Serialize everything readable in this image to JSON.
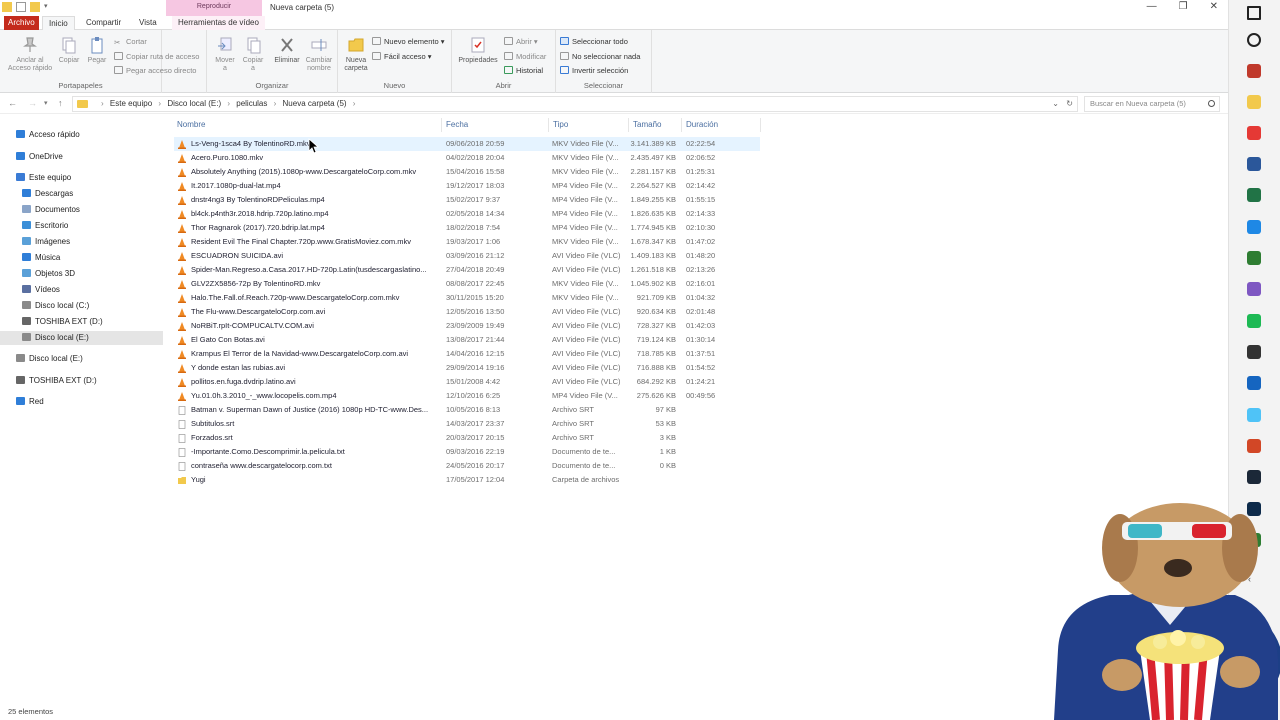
{
  "window": {
    "title": "Nueva carpeta (5)",
    "context_tab": "Reproducir",
    "controls": [
      "—",
      "❐",
      "✕"
    ]
  },
  "tabs": {
    "archivo": "Archivo",
    "inicio": "Inicio",
    "compartir": "Compartir",
    "vista": "Vista",
    "herramientas": "Herramientas de vídeo"
  },
  "ribbon": {
    "portapapeles": {
      "label": "Portapapeles",
      "anclar": "Anclar al\nAcceso rápido",
      "copiar": "Copiar",
      "pegar": "Pegar",
      "cortar": "Cortar",
      "copiar_ruta": "Copiar ruta de acceso",
      "pegar_acceso": "Pegar acceso directo"
    },
    "organizar": {
      "label": "Organizar",
      "mover": "Mover\na",
      "copiar_a": "Copiar\na",
      "eliminar": "Eliminar",
      "cambiar_nombre": "Cambiar\nnombre"
    },
    "nuevo": {
      "label": "Nuevo",
      "nueva_carpeta": "Nueva\ncarpeta",
      "nuevo_elemento": "Nuevo elemento",
      "facil_acceso": "Fácil acceso"
    },
    "abrir": {
      "label": "Abrir",
      "propiedades": "Propiedades",
      "abrir": "Abrir",
      "modificar": "Modificar",
      "historial": "Historial"
    },
    "seleccionar": {
      "label": "Seleccionar",
      "todo": "Seleccionar todo",
      "nada": "No seleccionar nada",
      "invertir": "Invertir selección"
    }
  },
  "address": {
    "crumbs": [
      "Este equipo",
      "Disco local (E:)",
      "peliculas",
      "Nueva carpeta (5)"
    ],
    "search_placeholder": "Buscar en Nueva carpeta (5)"
  },
  "sidebar": {
    "items": [
      {
        "label": "Acceso rápido",
        "color": "#2f7ed8"
      },
      {
        "label": "OneDrive",
        "color": "#2f7ed8"
      },
      {
        "label": "Este equipo",
        "color": "#3a7bd5"
      },
      {
        "label": "Descargas",
        "color": "#2f7ed8"
      },
      {
        "label": "Documentos",
        "color": "#8aa4c8"
      },
      {
        "label": "Escritorio",
        "color": "#3b8fd8"
      },
      {
        "label": "Imágenes",
        "color": "#5aa0d8"
      },
      {
        "label": "Música",
        "color": "#2f7ed8"
      },
      {
        "label": "Objetos 3D",
        "color": "#5aa0d8"
      },
      {
        "label": "Vídeos",
        "color": "#5a6fa0"
      },
      {
        "label": "Disco local (C:)",
        "color": "#8a8a8a"
      },
      {
        "label": "TOSHIBA EXT (D:)",
        "color": "#666666"
      },
      {
        "label": "Disco local (E:)",
        "color": "#8a8a8a"
      },
      {
        "label": "Disco local (E:)",
        "color": "#8a8a8a"
      },
      {
        "label": "TOSHIBA EXT (D:)",
        "color": "#666666"
      },
      {
        "label": "Red",
        "color": "#2f7ed8"
      }
    ]
  },
  "columns": {
    "nombre": "Nombre",
    "fecha": "Fecha",
    "tipo": "Tipo",
    "tamano": "Tamaño",
    "duracion": "Duración"
  },
  "files": [
    {
      "name": "Ls-Veng-1sca4 By TolentinoRD.mkv",
      "date": "09/06/2018 20:59",
      "type": "MKV Video File (V...",
      "size": "3.141.389 KB",
      "dur": "02:22:54",
      "kind": "vlc"
    },
    {
      "name": "Acero.Puro.1080.mkv",
      "date": "04/02/2018 20:04",
      "type": "MKV Video File (V...",
      "size": "2.435.497 KB",
      "dur": "02:06:52",
      "kind": "vlc"
    },
    {
      "name": "Absolutely Anything (2015).1080p-www.DescargateloCorp.com.mkv",
      "date": "15/04/2016 15:58",
      "type": "MKV Video File (V...",
      "size": "2.281.157 KB",
      "dur": "01:25:31",
      "kind": "vlc"
    },
    {
      "name": "It.2017.1080p-dual-lat.mp4",
      "date": "19/12/2017 18:03",
      "type": "MP4 Video File (V...",
      "size": "2.264.527 KB",
      "dur": "02:14:42",
      "kind": "vlc"
    },
    {
      "name": "dnstr4ng3 By TolentinoRDPeliculas.mp4",
      "date": "15/02/2017 9:37",
      "type": "MP4 Video File (V...",
      "size": "1.849.255 KB",
      "dur": "01:55:15",
      "kind": "vlc"
    },
    {
      "name": "bl4ck.p4nth3r.2018.hdrip.720p.latino.mp4",
      "date": "02/05/2018 14:34",
      "type": "MP4 Video File (V...",
      "size": "1.826.635 KB",
      "dur": "02:14:33",
      "kind": "vlc"
    },
    {
      "name": "Thor Ragnarok (2017).720.bdrip.lat.mp4",
      "date": "18/02/2018 7:54",
      "type": "MP4 Video File (V...",
      "size": "1.774.945 KB",
      "dur": "02:10:30",
      "kind": "vlc"
    },
    {
      "name": "Resident Evil The Final Chapter.720p.www.GratisMoviez.com.mkv",
      "date": "19/03/2017 1:06",
      "type": "MKV Video File (V...",
      "size": "1.678.347 KB",
      "dur": "01:47:02",
      "kind": "vlc"
    },
    {
      "name": "ESCUADRON SUICIDA.avi",
      "date": "03/09/2016 21:12",
      "type": "AVI Video File (VLC)",
      "size": "1.409.183 KB",
      "dur": "01:48:20",
      "kind": "vlc"
    },
    {
      "name": "Spider-Man.Regreso.a.Casa.2017.HD-720p.Latin(tusdescargaslatino...",
      "date": "27/04/2018 20:49",
      "type": "AVI Video File (VLC)",
      "size": "1.261.518 KB",
      "dur": "02:13:26",
      "kind": "vlc"
    },
    {
      "name": "GLV2ZX5856-72p By TolentinoRD.mkv",
      "date": "08/08/2017 22:45",
      "type": "MKV Video File (V...",
      "size": "1.045.902 KB",
      "dur": "02:16:01",
      "kind": "vlc"
    },
    {
      "name": "Halo.The.Fall.of.Reach.720p-www.DescargateloCorp.com.mkv",
      "date": "30/11/2015 15:20",
      "type": "MKV Video File (V...",
      "size": "921.709 KB",
      "dur": "01:04:32",
      "kind": "vlc"
    },
    {
      "name": "The Flu-www.DescargateloCorp.com.avi",
      "date": "12/05/2016 13:50",
      "type": "AVI Video File (VLC)",
      "size": "920.634 KB",
      "dur": "02:01:48",
      "kind": "vlc"
    },
    {
      "name": "NoRBiT.rpIt-COMPUCALTV.COM.avi",
      "date": "23/09/2009 19:49",
      "type": "AVI Video File (VLC)",
      "size": "728.327 KB",
      "dur": "01:42:03",
      "kind": "vlc"
    },
    {
      "name": "El Gato Con Botas.avi",
      "date": "13/08/2017 21:44",
      "type": "AVI Video File (VLC)",
      "size": "719.124 KB",
      "dur": "01:30:14",
      "kind": "vlc"
    },
    {
      "name": "Krampus El Terror de la Navidad-www.DescargateloCorp.com.avi",
      "date": "14/04/2016 12:15",
      "type": "AVI Video File (VLC)",
      "size": "718.785 KB",
      "dur": "01:37:51",
      "kind": "vlc"
    },
    {
      "name": "Y donde estan las rubias.avi",
      "date": "29/09/2014 19:16",
      "type": "AVI Video File (VLC)",
      "size": "716.888 KB",
      "dur": "01:54:52",
      "kind": "vlc"
    },
    {
      "name": "pollitos.en.fuga.dvdrip.latino.avi",
      "date": "15/01/2008 4:42",
      "type": "AVI Video File (VLC)",
      "size": "684.292 KB",
      "dur": "01:24:21",
      "kind": "vlc"
    },
    {
      "name": "Yu.01.0h.3.2010_-_www.locopelis.com.mp4",
      "date": "12/10/2016 6:25",
      "type": "MP4 Video File (V...",
      "size": "275.626 KB",
      "dur": "00:49:56",
      "kind": "vlc"
    },
    {
      "name": "Batman v. Superman Dawn of Justice (2016) 1080p HD-TC-www.Des...",
      "date": "10/05/2016 8:13",
      "type": "Archivo SRT",
      "size": "97 KB",
      "dur": "",
      "kind": "doc"
    },
    {
      "name": "Subtitulos.srt",
      "date": "14/03/2017 23:37",
      "type": "Archivo SRT",
      "size": "53 KB",
      "dur": "",
      "kind": "doc"
    },
    {
      "name": "Forzados.srt",
      "date": "20/03/2017 20:15",
      "type": "Archivo SRT",
      "size": "3 KB",
      "dur": "",
      "kind": "doc"
    },
    {
      "name": "-Importante.Como.Descomprimir.la.pelicula.txt",
      "date": "09/03/2016 22:19",
      "type": "Documento de te...",
      "size": "1 KB",
      "dur": "",
      "kind": "doc"
    },
    {
      "name": "contraseña www.descargatelocorp.com.txt",
      "date": "24/05/2016 20:17",
      "type": "Documento de te...",
      "size": "0 KB",
      "dur": "",
      "kind": "doc"
    },
    {
      "name": "Yugi",
      "date": "17/05/2017 12:04",
      "type": "Carpeta de archivos",
      "size": "",
      "dur": "",
      "kind": "folder"
    }
  ],
  "status": "25 elementos",
  "taskbar": [
    {
      "name": "windows-icon",
      "color": "#222222"
    },
    {
      "name": "search-icon",
      "color": "#222222"
    },
    {
      "name": "app-icon",
      "color": "#c0392b"
    },
    {
      "name": "file-explorer-icon",
      "color": "#f2c94c"
    },
    {
      "name": "chrome-icon",
      "color": "#e53935"
    },
    {
      "name": "word-icon",
      "color": "#2b579a"
    },
    {
      "name": "excel-icon",
      "color": "#217346"
    },
    {
      "name": "edge-icon",
      "color": "#1e88e5"
    },
    {
      "name": "app-icon",
      "color": "#2e7d32"
    },
    {
      "name": "app-icon",
      "color": "#7e57c2"
    },
    {
      "name": "spotify-icon",
      "color": "#1db954"
    },
    {
      "name": "media-icon",
      "color": "#333333"
    },
    {
      "name": "app-icon",
      "color": "#1565c0"
    },
    {
      "name": "app-icon",
      "color": "#4fc3f7"
    },
    {
      "name": "powerpoint-icon",
      "color": "#d24726"
    },
    {
      "name": "steam-icon",
      "color": "#1b2838"
    },
    {
      "name": "photoshop-icon",
      "color": "#0d2a4a"
    },
    {
      "name": "app-icon",
      "color": "#2e7d32"
    }
  ]
}
